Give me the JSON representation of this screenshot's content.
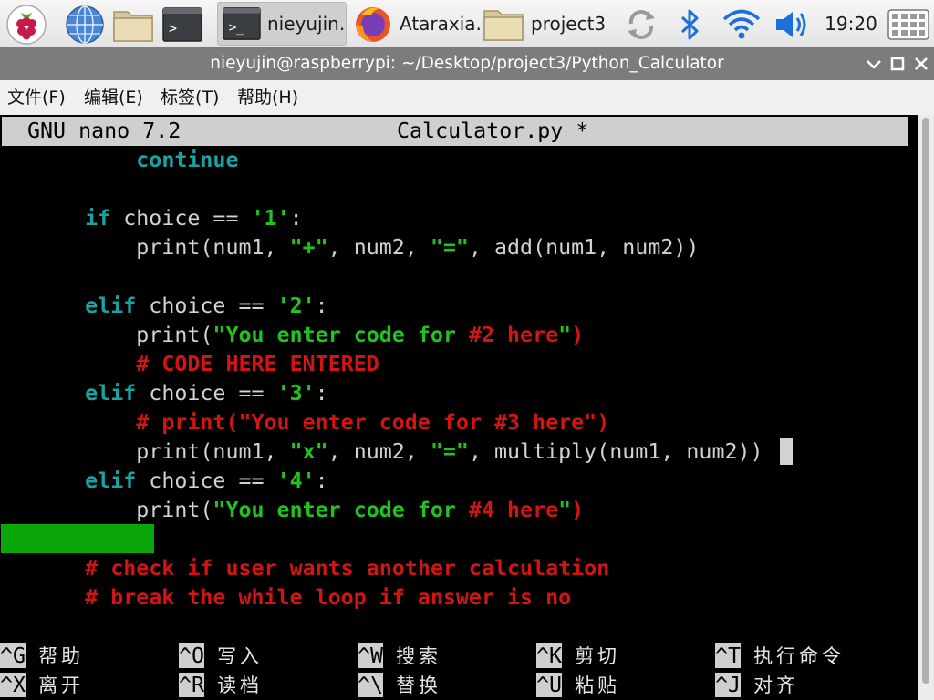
{
  "taskbar": {
    "launcher_icons": [
      "raspberry-pi-menu-icon",
      "web-browser-icon",
      "file-manager-icon",
      "terminal-icon"
    ],
    "tasks": [
      {
        "label": "nieyujin..",
        "icon": "terminal-icon",
        "active": true
      },
      {
        "label": "Ataraxia..",
        "icon": "firefox-icon",
        "active": false
      },
      {
        "label": "project3",
        "icon": "folder-icon",
        "active": false
      }
    ],
    "tray_icons": [
      "sync-icon",
      "bluetooth-icon",
      "wifi-icon",
      "volume-icon",
      "app-grid-icon"
    ],
    "clock": "19:20"
  },
  "window": {
    "title": "nieyujin@raspberrypi: ~/Desktop/project3/Python_Calculator",
    "controls": [
      "minimize-icon",
      "maximize-icon",
      "close-icon"
    ]
  },
  "menu": {
    "items": [
      "文件(F)",
      "编辑(E)",
      "标签(T)",
      "帮助(H)"
    ]
  },
  "nano": {
    "version": "GNU nano 7.2",
    "filename": "Calculator.py *",
    "lines": [
      [
        {
          "t": "          "
        },
        {
          "t": "continue",
          "c": "kw"
        }
      ],
      [],
      [
        {
          "t": "      "
        },
        {
          "t": "if",
          "c": "kw"
        },
        {
          "t": " choice == "
        },
        {
          "t": "'1'",
          "c": "str"
        },
        {
          "t": ":"
        }
      ],
      [
        {
          "t": "          print(num1, "
        },
        {
          "t": "\"+\"",
          "c": "str"
        },
        {
          "t": ", num2, "
        },
        {
          "t": "\"=\"",
          "c": "str"
        },
        {
          "t": ", add(num1, num2))"
        }
      ],
      [],
      [
        {
          "t": "      "
        },
        {
          "t": "elif",
          "c": "kw"
        },
        {
          "t": " choice == "
        },
        {
          "t": "'2'",
          "c": "str"
        },
        {
          "t": ":"
        }
      ],
      [
        {
          "t": "          print("
        },
        {
          "t": "\"You enter code for ",
          "c": "str"
        },
        {
          "t": "#2 here",
          "c": "num"
        },
        {
          "t": "\"",
          "c": "str"
        },
        {
          "t": ")",
          "c": "cmt"
        }
      ],
      [
        {
          "t": "          "
        },
        {
          "t": "# CODE HERE ENTERED",
          "c": "cmt"
        }
      ],
      [
        {
          "t": "      "
        },
        {
          "t": "elif",
          "c": "kw"
        },
        {
          "t": " choice == "
        },
        {
          "t": "'3'",
          "c": "str"
        },
        {
          "t": ":"
        }
      ],
      [
        {
          "t": "          "
        },
        {
          "t": "# print(\"You enter code for #3 here\")",
          "c": "cmt"
        }
      ],
      [
        {
          "t": "          print(num1, "
        },
        {
          "t": "\"x\"",
          "c": "str"
        },
        {
          "t": ", num2, "
        },
        {
          "t": "\"=\"",
          "c": "str"
        },
        {
          "t": ", multiply(num1, num2))"
        }
      ],
      [
        {
          "t": "      "
        },
        {
          "t": "elif",
          "c": "kw"
        },
        {
          "t": " choice == "
        },
        {
          "t": "'4'",
          "c": "str"
        },
        {
          "t": ":"
        }
      ],
      [
        {
          "t": "          print("
        },
        {
          "t": "\"You enter code for ",
          "c": "str"
        },
        {
          "t": "#4 here",
          "c": "num"
        },
        {
          "t": "\"",
          "c": "str"
        },
        {
          "t": ")",
          "c": "cmt"
        }
      ],
      [],
      [
        {
          "t": "      "
        },
        {
          "t": "# check if user wants another calculation",
          "c": "cmt"
        }
      ],
      [
        {
          "t": "      "
        },
        {
          "t": "# break the while loop if answer is no",
          "c": "cmt"
        }
      ]
    ],
    "shortcuts": [
      {
        "key": "^G",
        "label": "帮助"
      },
      {
        "key": "^O",
        "label": "写入"
      },
      {
        "key": "^W",
        "label": "搜索"
      },
      {
        "key": "^K",
        "label": "剪切"
      },
      {
        "key": "^T",
        "label": "执行命令"
      },
      {
        "key": "^X",
        "label": "离开"
      },
      {
        "key": "^R",
        "label": "读档"
      },
      {
        "key": "^\\",
        "label": "替换"
      },
      {
        "key": "^U",
        "label": "粘贴"
      },
      {
        "key": "^J",
        "label": "对齐"
      }
    ]
  },
  "colors": {
    "keyword": "#1aa3a3",
    "string": "#1fc41f",
    "comment": "#d11414",
    "whitespace_highlight": "#0aa60a",
    "title_bar": "#7a7c7e"
  }
}
